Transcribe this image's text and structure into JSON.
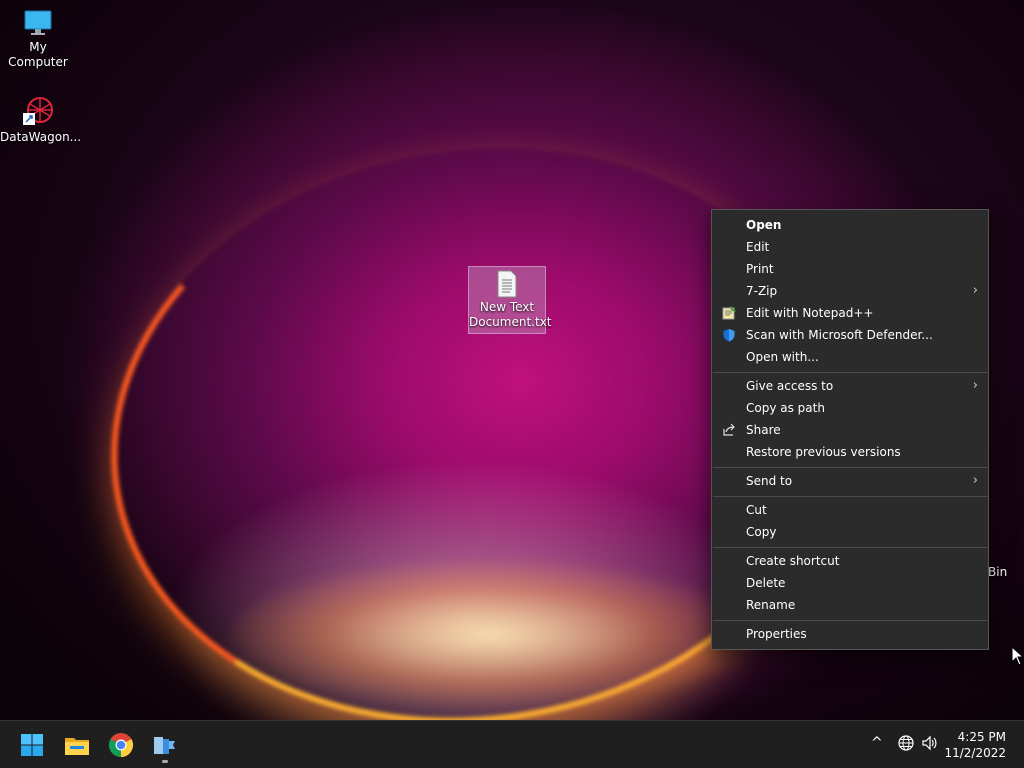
{
  "desktop": {
    "icons": [
      {
        "label": "My Computer",
        "icon": "monitor-icon"
      },
      {
        "label": "DataWagon...",
        "icon": "datawagon-shortcut-icon"
      },
      {
        "label": "New Text Document.txt",
        "label_line1": "New Text",
        "label_line2": "Document.txt",
        "icon": "text-file-icon"
      }
    ],
    "recycle_bin_label": "Bin"
  },
  "context_menu": {
    "items": [
      {
        "label": "Open",
        "bold": true
      },
      {
        "label": "Edit"
      },
      {
        "label": "Print"
      },
      {
        "label": "7-Zip",
        "submenu": true
      },
      {
        "label": "Edit with Notepad++",
        "icon": "notepadpp-icon"
      },
      {
        "label": "Scan with Microsoft Defender...",
        "icon": "defender-shield-icon"
      },
      {
        "label": "Open with..."
      },
      {
        "label": "Give access to",
        "submenu": true
      },
      {
        "label": "Copy as path"
      },
      {
        "label": "Share",
        "icon": "share-icon"
      },
      {
        "label": "Restore previous versions"
      },
      {
        "label": "Send to",
        "submenu": true
      },
      {
        "label": "Cut"
      },
      {
        "label": "Copy"
      },
      {
        "label": "Create shortcut"
      },
      {
        "label": "Delete"
      },
      {
        "label": "Rename"
      },
      {
        "label": "Properties"
      }
    ],
    "submenu_arrow": "›"
  },
  "taskbar": {
    "apps": [
      "start-icon",
      "file-explorer-icon",
      "chrome-icon",
      "server-manager-icon"
    ],
    "tray": {
      "chevron": "^",
      "time": "4:25 PM",
      "date": "11/2/2022"
    }
  },
  "colors": {
    "menu_bg": "#2b2b2b",
    "taskbar_bg": "#1f1f1f",
    "accent": "#0078d4"
  }
}
